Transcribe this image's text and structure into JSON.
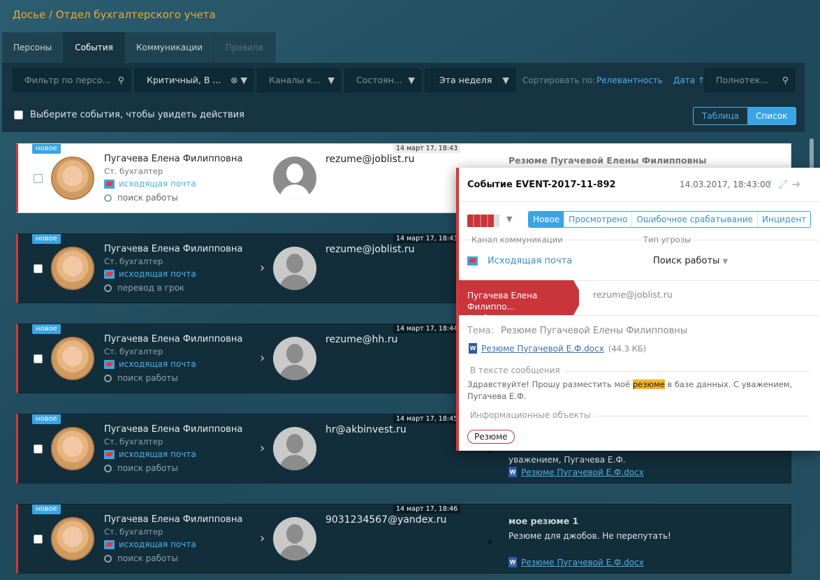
{
  "breadcrumb": "Досье / Отдел бухгалтерского учета",
  "tabs": [
    {
      "label": "Персоны"
    },
    {
      "label": "События"
    },
    {
      "label": "Коммуникации"
    },
    {
      "label": "Правила"
    }
  ],
  "filters": {
    "person_placeholder": "Фильтр по персо...",
    "criticality": "Критичный, В ...",
    "channels": "Каналы к...",
    "state": "Состоян...",
    "period": "Эта неделя",
    "sort_label": "Сортировать по:",
    "sort_relevance": "Релевантность",
    "sort_date": "Дата ↑",
    "fulltext_placeholder": "Полнотек..."
  },
  "select_hint": "Выберите события, чтобы увидеть действия",
  "view_toggle": {
    "table": "Таблица",
    "list": "Список"
  },
  "colors": {
    "accent": "#3aa4e4",
    "critical": "#d13a3a",
    "orange": "#f0a830"
  },
  "events": [
    {
      "badge": "новое",
      "name": "Пугачева Елена Филипповна",
      "position": "Ст. бухгалтер",
      "channel": "исходящая почта",
      "threat": "поиск работы",
      "recipient": "rezume@joblist.ru",
      "date": "14 март 17, 18:43",
      "subject": "Резюме Пугачевой Елены Филипповны",
      "body": "",
      "attachment": ""
    },
    {
      "badge": "новое",
      "name": "Пугачева Елена Филипповна",
      "position": "Ст. бухгалтер",
      "channel": "исходящая почта",
      "threat": "перевод в грок",
      "recipient": "rezume@joblist.ru",
      "date": "14 март 17, 18:43",
      "subject": "",
      "body": "",
      "attachment": ""
    },
    {
      "badge": "новое",
      "name": "Пугачева Елена Филипповна",
      "position": "Ст. бухгалтер",
      "channel": "исходящая почта",
      "threat": "поиск работы",
      "recipient": "rezume@hh.ru",
      "date": "14 март 17, 18:44",
      "subject": "",
      "body": "",
      "attachment": ""
    },
    {
      "badge": "новое",
      "name": "Пугачева Елена Филипповна",
      "position": "Ст. бухгалтер",
      "channel": "исходящая почта",
      "threat": "поиск работы",
      "recipient": "hr@akbinvest.ru",
      "date": "14 март 17, 18:45",
      "subject": "",
      "body": "уважением, Пугачева Е.Ф.",
      "attachment": "Резюме Пугачевой Е.Ф.docx"
    },
    {
      "badge": "новое",
      "name": "Пугачева Елена Филипповна",
      "position": "Ст. бухгалтер",
      "channel": "исходящая почта",
      "threat": "поиск работы",
      "recipient": "9031234567@yandex.ru",
      "date": "14 март 17, 18:46",
      "subject": "мое резюме 1",
      "body": "Резюме для джобов. Не перепутать!",
      "attachment": "Резюме Пугачевой Е.Ф.docx"
    }
  ],
  "detail": {
    "title": "Событие EVENT-2017-11-892",
    "datetime": "14.03.2017, 18:43:00",
    "statuses": [
      "Новое",
      "Просмотрено",
      "Ошибочное срабатывание",
      "Инцидент"
    ],
    "channel_label": "Канал коммуникации",
    "threat_label": "Тип угрозы",
    "channel": "Исходящая почта",
    "threat": "Поиск работы",
    "sender_name": "Пугачева Елена Филиппо...",
    "sender_position": "Ст. бухгалтер",
    "recipient": "rezume@joblist.ru",
    "topic_label": "Тема:",
    "topic": "Резюме Пугачевой Елены Филипповны",
    "attachment": "Резюме Пугачевой Е.Ф.docx",
    "attachment_size": "(44.3 КБ)",
    "msg_label": "В тексте сообщения",
    "msg_before": "Здравствуйте! Прошу разместить моё ",
    "msg_highlight": "резюме",
    "msg_after": " в базе данных. С уважением, Пугачева Е.Ф.",
    "objects_label": "Информационные объекты",
    "object_tag": "Резюме"
  }
}
